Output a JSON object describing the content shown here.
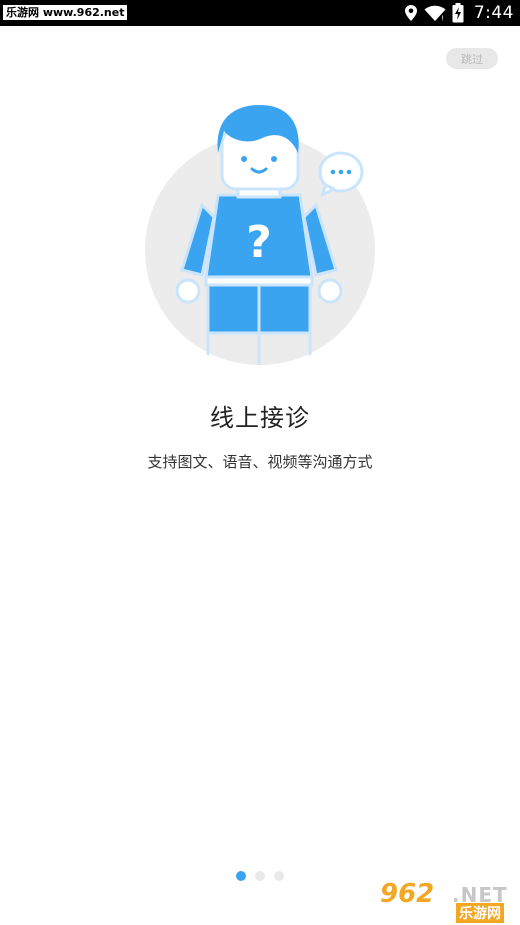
{
  "status_bar": {
    "watermark": "乐游网 www.962.net",
    "time": "7:44",
    "icons": [
      "location-icon",
      "wifi-icon",
      "battery-charging-icon"
    ]
  },
  "skip_label": "跳过",
  "illustration": {
    "icons": [
      "person-question-icon",
      "speech-bubble-icon"
    ],
    "colors": {
      "accent": "#3ba4f0",
      "circle": "#ececec",
      "outline": "#c9e4fb"
    }
  },
  "onboarding": {
    "title": "线上接诊",
    "subtitle": "支持图文、语音、视频等沟通方式"
  },
  "pager": {
    "total": 3,
    "current": 1
  },
  "watermark_corner": {
    "logo": "962",
    "net": ".NET",
    "text": "乐游网"
  }
}
